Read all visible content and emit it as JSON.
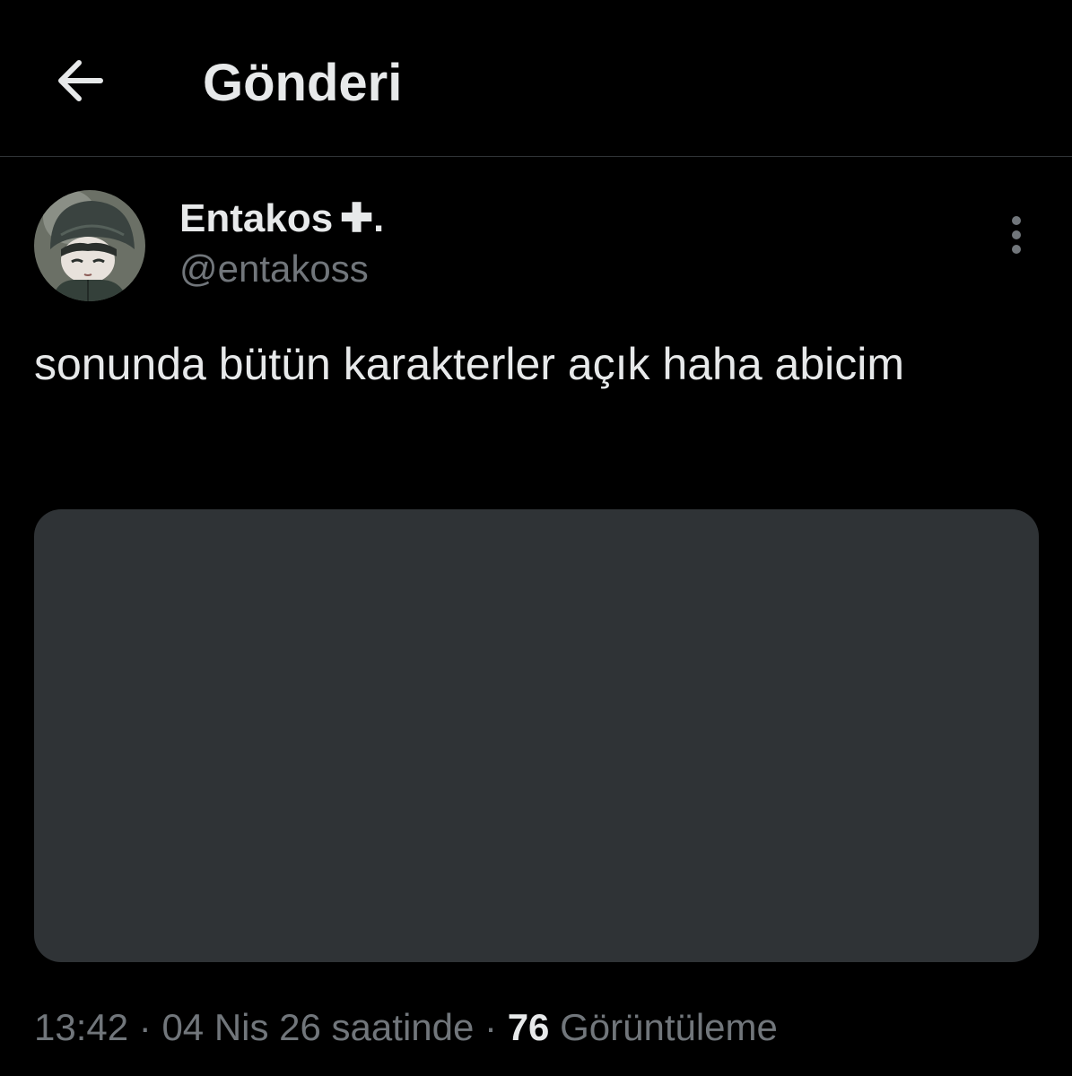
{
  "header": {
    "title": "Gönderi",
    "back_icon": "arrow-left-icon"
  },
  "post": {
    "author": {
      "display_name": "Entakos",
      "name_suffix": "✚.",
      "handle": "@entakoss"
    },
    "more_icon": "vertical-ellipsis-icon",
    "text": "sonunda bütün karakterler açık haha abicim",
    "meta": {
      "time": "13:42",
      "separator": "·",
      "date": "04 Nis 26 saatinde",
      "views_count": "76",
      "views_label": "Görüntüleme"
    }
  },
  "colors": {
    "background": "#000000",
    "text_primary": "#e7e9ea",
    "text_secondary": "#71767b",
    "divider": "#2f3336",
    "media_placeholder": "#2f3336"
  }
}
